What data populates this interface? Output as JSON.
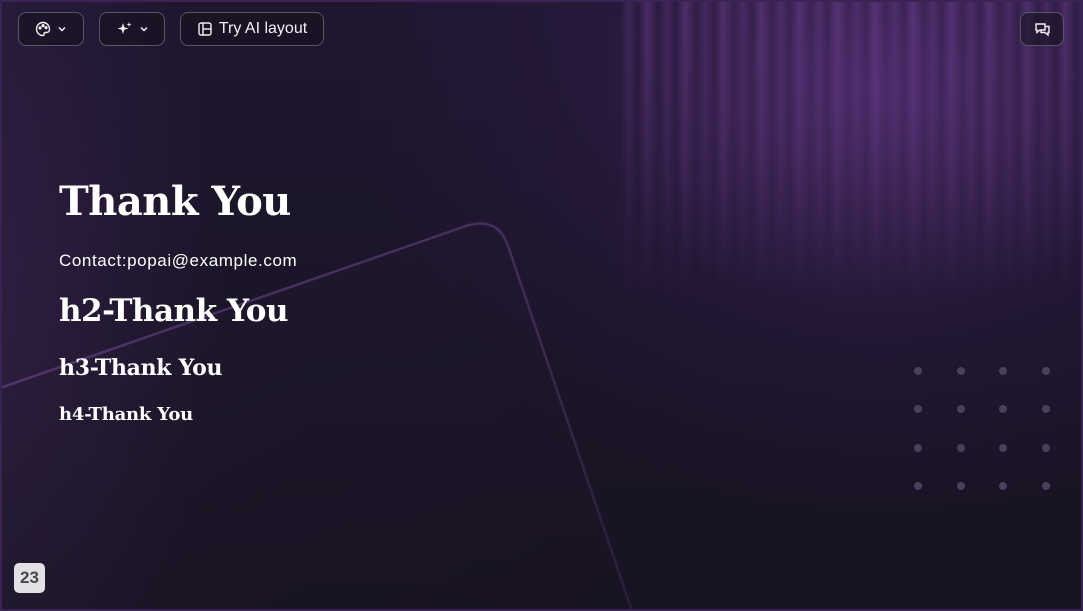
{
  "toolbar": {
    "palette_button": {
      "icon": "palette-icon",
      "dropdown_icon": "chevron-down-icon"
    },
    "ai_button": {
      "icon": "sparkles-icon",
      "dropdown_icon": "chevron-down-icon"
    },
    "layout_button": {
      "icon": "layout-icon",
      "label": "Try AI layout"
    },
    "chat_button": {
      "icon": "chat-icon"
    }
  },
  "slide": {
    "h1": "Thank You",
    "contact": "Contact:popai@example.com",
    "h2": "h2-Thank You",
    "h3": "h3-Thank You",
    "h4": "h4-Thank You"
  },
  "page_number": "23",
  "colors": {
    "background": "#1a1426",
    "accent_purple": "#6e3c96",
    "text": "#ffffff",
    "badge_bg": "#e3e1e6"
  }
}
